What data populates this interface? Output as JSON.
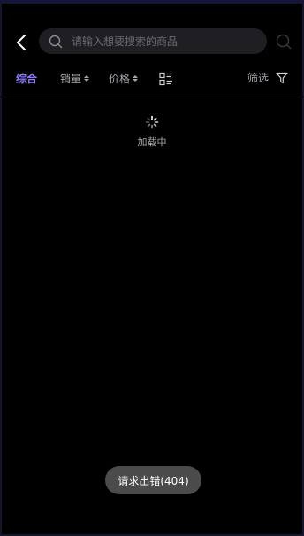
{
  "search": {
    "placeholder": "请输入想要搜索的商品"
  },
  "filters": {
    "comprehensive": "综合",
    "sales": "销量",
    "price": "价格",
    "filter": "筛选"
  },
  "loading": {
    "text": "加载中"
  },
  "toast": {
    "message": "请求出错(404)"
  },
  "colors": {
    "accent": "#8b7cf6",
    "background": "#000000",
    "toast_bg": "#4b4b4b"
  },
  "icons": [
    "back-icon",
    "search-icon",
    "list-layout-icon",
    "funnel-icon",
    "spinner-icon"
  ]
}
